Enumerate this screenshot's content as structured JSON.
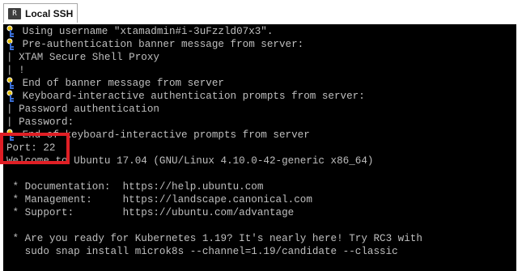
{
  "tab": {
    "icon_glyph": "R",
    "label": "Local SSH"
  },
  "terminal": {
    "lines": [
      "Using username \"xtamadmin#i-3uFzzld07x3\".",
      "Pre-authentication banner message from server:",
      "| XTAM Secure Shell Proxy",
      "| !",
      "End of banner message from server",
      "Keyboard-interactive authentication prompts from server:",
      "| Password authentication",
      "| Password:",
      "End of keyboard-interactive prompts from server",
      "Port: 22",
      "Welcome to Ubuntu 17.04 (GNU/Linux 4.10.0-42-generic x86_64)",
      "",
      " * Documentation:  https://help.ubuntu.com",
      " * Management:     https://landscape.canonical.com",
      " * Support:        https://ubuntu.com/advantage",
      "",
      " * Are you ready for Kubernetes 1.19? It's nearly here! Try RC3 with",
      "   sudo snap install microk8s --channel=1.19/candidate --classic"
    ]
  },
  "colors": {
    "terminal_bg": "#000000",
    "terminal_fg": "#bfbfbf",
    "highlight": "#e01f25"
  }
}
